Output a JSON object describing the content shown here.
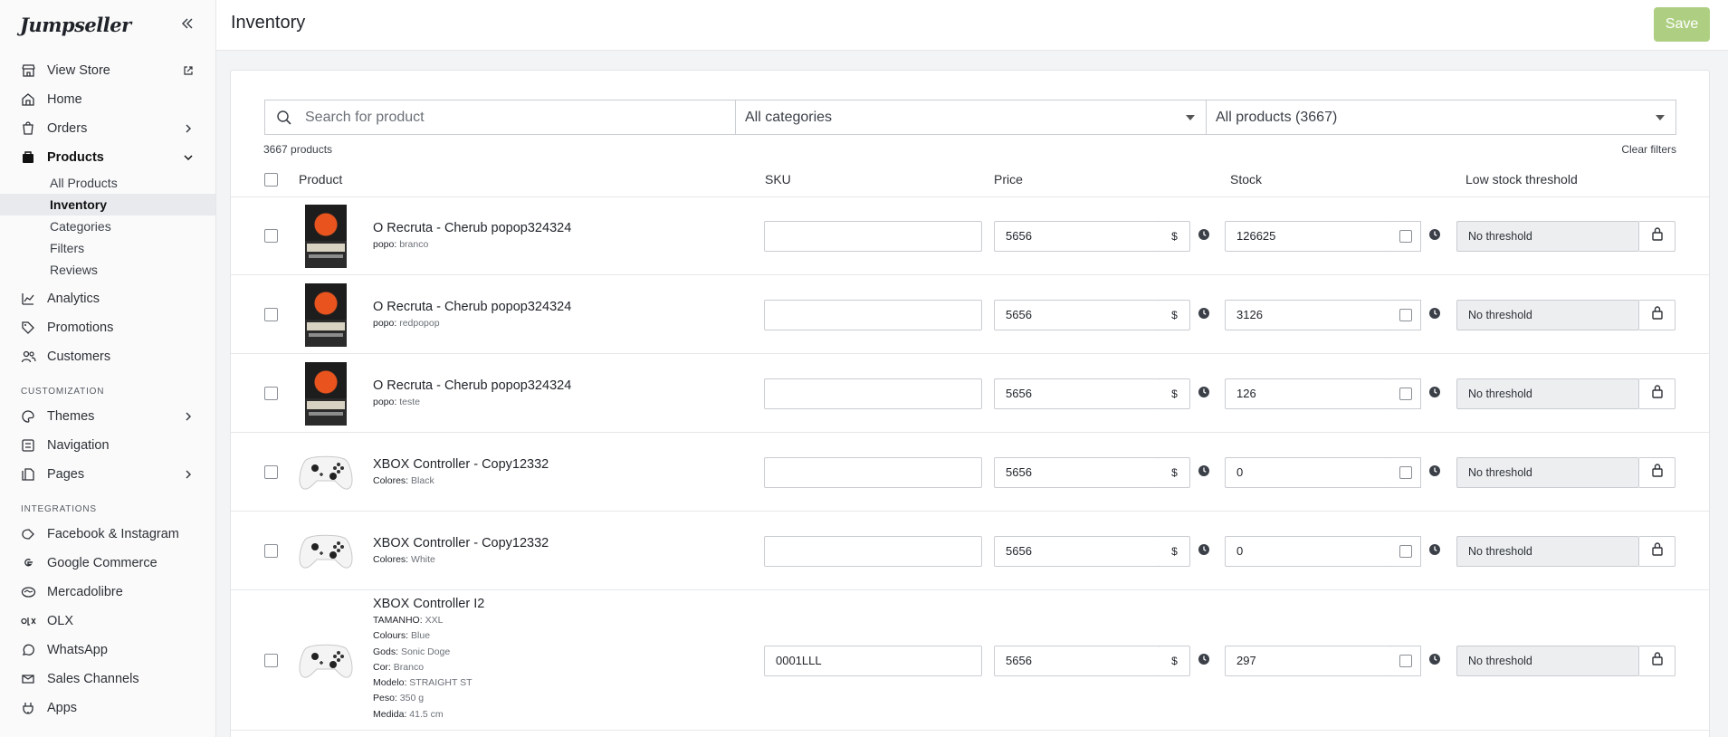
{
  "brand": {
    "name": "Jumpseller"
  },
  "sidebar": {
    "items": [
      {
        "label": "View Store"
      },
      {
        "label": "Home"
      },
      {
        "label": "Orders"
      },
      {
        "label": "Products"
      },
      {
        "label": "Analytics"
      },
      {
        "label": "Promotions"
      },
      {
        "label": "Customers"
      }
    ],
    "products_sub": [
      {
        "label": "All Products"
      },
      {
        "label": "Inventory"
      },
      {
        "label": "Categories"
      },
      {
        "label": "Filters"
      },
      {
        "label": "Reviews"
      }
    ],
    "customization_label": "CUSTOMIZATION",
    "customization": [
      {
        "label": "Themes"
      },
      {
        "label": "Navigation"
      },
      {
        "label": "Pages"
      }
    ],
    "integrations_label": "INTEGRATIONS",
    "integrations": [
      {
        "label": "Facebook & Instagram"
      },
      {
        "label": "Google Commerce"
      },
      {
        "label": "Mercadolibre"
      },
      {
        "label": "OLX"
      },
      {
        "label": "WhatsApp"
      },
      {
        "label": "Sales Channels"
      },
      {
        "label": "Apps"
      }
    ]
  },
  "header": {
    "title": "Inventory",
    "save_label": "Save"
  },
  "filters": {
    "search_placeholder": "Search for product",
    "category": "All categories",
    "products": "All products (3667)",
    "count": "3667 products",
    "clear": "Clear filters"
  },
  "table": {
    "headers": {
      "product": "Product",
      "sku": "SKU",
      "price": "Price",
      "stock": "Stock",
      "threshold": "Low stock threshold"
    },
    "currency": "$",
    "threshold_text": "No threshold",
    "rows": [
      {
        "name": "O Recruta - Cherub popop324324",
        "image": "book-cover",
        "attrs": [
          {
            "k": "popo:",
            "v": "branco"
          }
        ],
        "sku": "",
        "price": "5656",
        "stock": "126625"
      },
      {
        "name": "O Recruta - Cherub popop324324",
        "image": "book-cover",
        "attrs": [
          {
            "k": "popo:",
            "v": "redpopop"
          }
        ],
        "sku": "",
        "price": "5656",
        "stock": "3126"
      },
      {
        "name": "O Recruta - Cherub popop324324",
        "image": "book-cover",
        "attrs": [
          {
            "k": "popo:",
            "v": "teste"
          }
        ],
        "sku": "",
        "price": "5656",
        "stock": "126"
      },
      {
        "name": "XBOX Controller - Copy12332",
        "image": "xbox-controller",
        "attrs": [
          {
            "k": "Colores:",
            "v": "Black"
          }
        ],
        "sku": "",
        "price": "5656",
        "stock": "0"
      },
      {
        "name": "XBOX Controller - Copy12332",
        "image": "xbox-controller",
        "attrs": [
          {
            "k": "Colores:",
            "v": "White"
          }
        ],
        "sku": "",
        "price": "5656",
        "stock": "0"
      },
      {
        "name": "XBOX Controller  I2",
        "image": "xbox-controller",
        "attrs": [
          {
            "k": "TAMANHO:",
            "v": "XXL"
          },
          {
            "k": "Colours:",
            "v": "Blue"
          },
          {
            "k": "Gods:",
            "v": "Sonic Doge"
          },
          {
            "k": "Cor:",
            "v": "Branco"
          },
          {
            "k": "Modelo:",
            "v": "STRAIGHT ST"
          },
          {
            "k": "Peso:",
            "v": "350 g"
          },
          {
            "k": "Medida:",
            "v": "41.5 cm"
          }
        ],
        "sku": "0001LLL",
        "price": "5656",
        "stock": "297"
      }
    ]
  }
}
